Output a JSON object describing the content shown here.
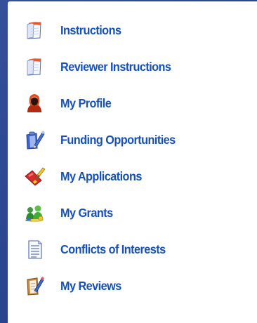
{
  "menu": {
    "items": [
      {
        "label": "Instructions",
        "icon": "document-icon"
      },
      {
        "label": "Reviewer Instructions",
        "icon": "document-icon"
      },
      {
        "label": "My Profile",
        "icon": "user-profile-icon"
      },
      {
        "label": "Funding Opportunities",
        "icon": "clipboard-pencil-icon"
      },
      {
        "label": "My Applications",
        "icon": "brush-tools-icon"
      },
      {
        "label": "My Grants",
        "icon": "money-people-icon"
      },
      {
        "label": "Conflicts of Interests",
        "icon": "lined-document-icon"
      },
      {
        "label": "My Reviews",
        "icon": "review-notepad-icon"
      }
    ]
  },
  "colors": {
    "link": "#1550bd",
    "background": "#2a4690",
    "panel": "#ffffff"
  }
}
